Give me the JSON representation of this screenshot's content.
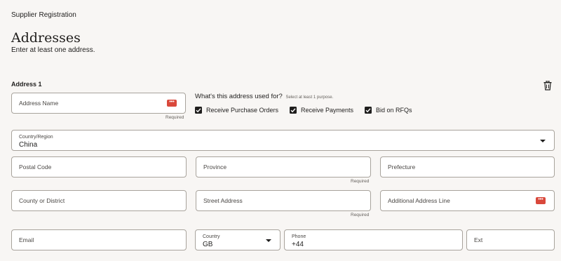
{
  "header": {
    "app_title": "Supplier Registration",
    "page_title": "Addresses",
    "page_subtitle": "Enter at least one address."
  },
  "section": {
    "title": "Address 1"
  },
  "purpose": {
    "question": "What's this address used for?",
    "hint": "Select at least 1 purpose.",
    "options": [
      {
        "label": "Receive Purchase Orders",
        "checked": true
      },
      {
        "label": "Receive Payments",
        "checked": true
      },
      {
        "label": "Bid on RFQs",
        "checked": true
      }
    ]
  },
  "fields": {
    "address_name": {
      "placeholder": "Address Name",
      "required": "Required"
    },
    "country_region": {
      "label": "Country/Region",
      "value": "China"
    },
    "postal_code": {
      "placeholder": "Postal Code"
    },
    "province": {
      "placeholder": "Province",
      "required": "Required"
    },
    "prefecture": {
      "placeholder": "Prefecture"
    },
    "county": {
      "placeholder": "County or District"
    },
    "street": {
      "placeholder": "Street Address",
      "required": "Required"
    },
    "additional": {
      "placeholder": "Additional Address Line"
    },
    "email": {
      "placeholder": "Email"
    },
    "country": {
      "label": "Country",
      "value": "GB"
    },
    "phone": {
      "label": "Phone",
      "value": "+44"
    },
    "ext": {
      "placeholder": "Ext"
    }
  },
  "icons": {
    "delete": "trash-icon",
    "autofill": "password-dots-icon",
    "dropdown": "chevron-down-icon",
    "check": "check-icon"
  },
  "colors": {
    "background": "#f8f6f4",
    "autofill_badge": "#d9483b",
    "checkbox": "#1f1e1d"
  }
}
